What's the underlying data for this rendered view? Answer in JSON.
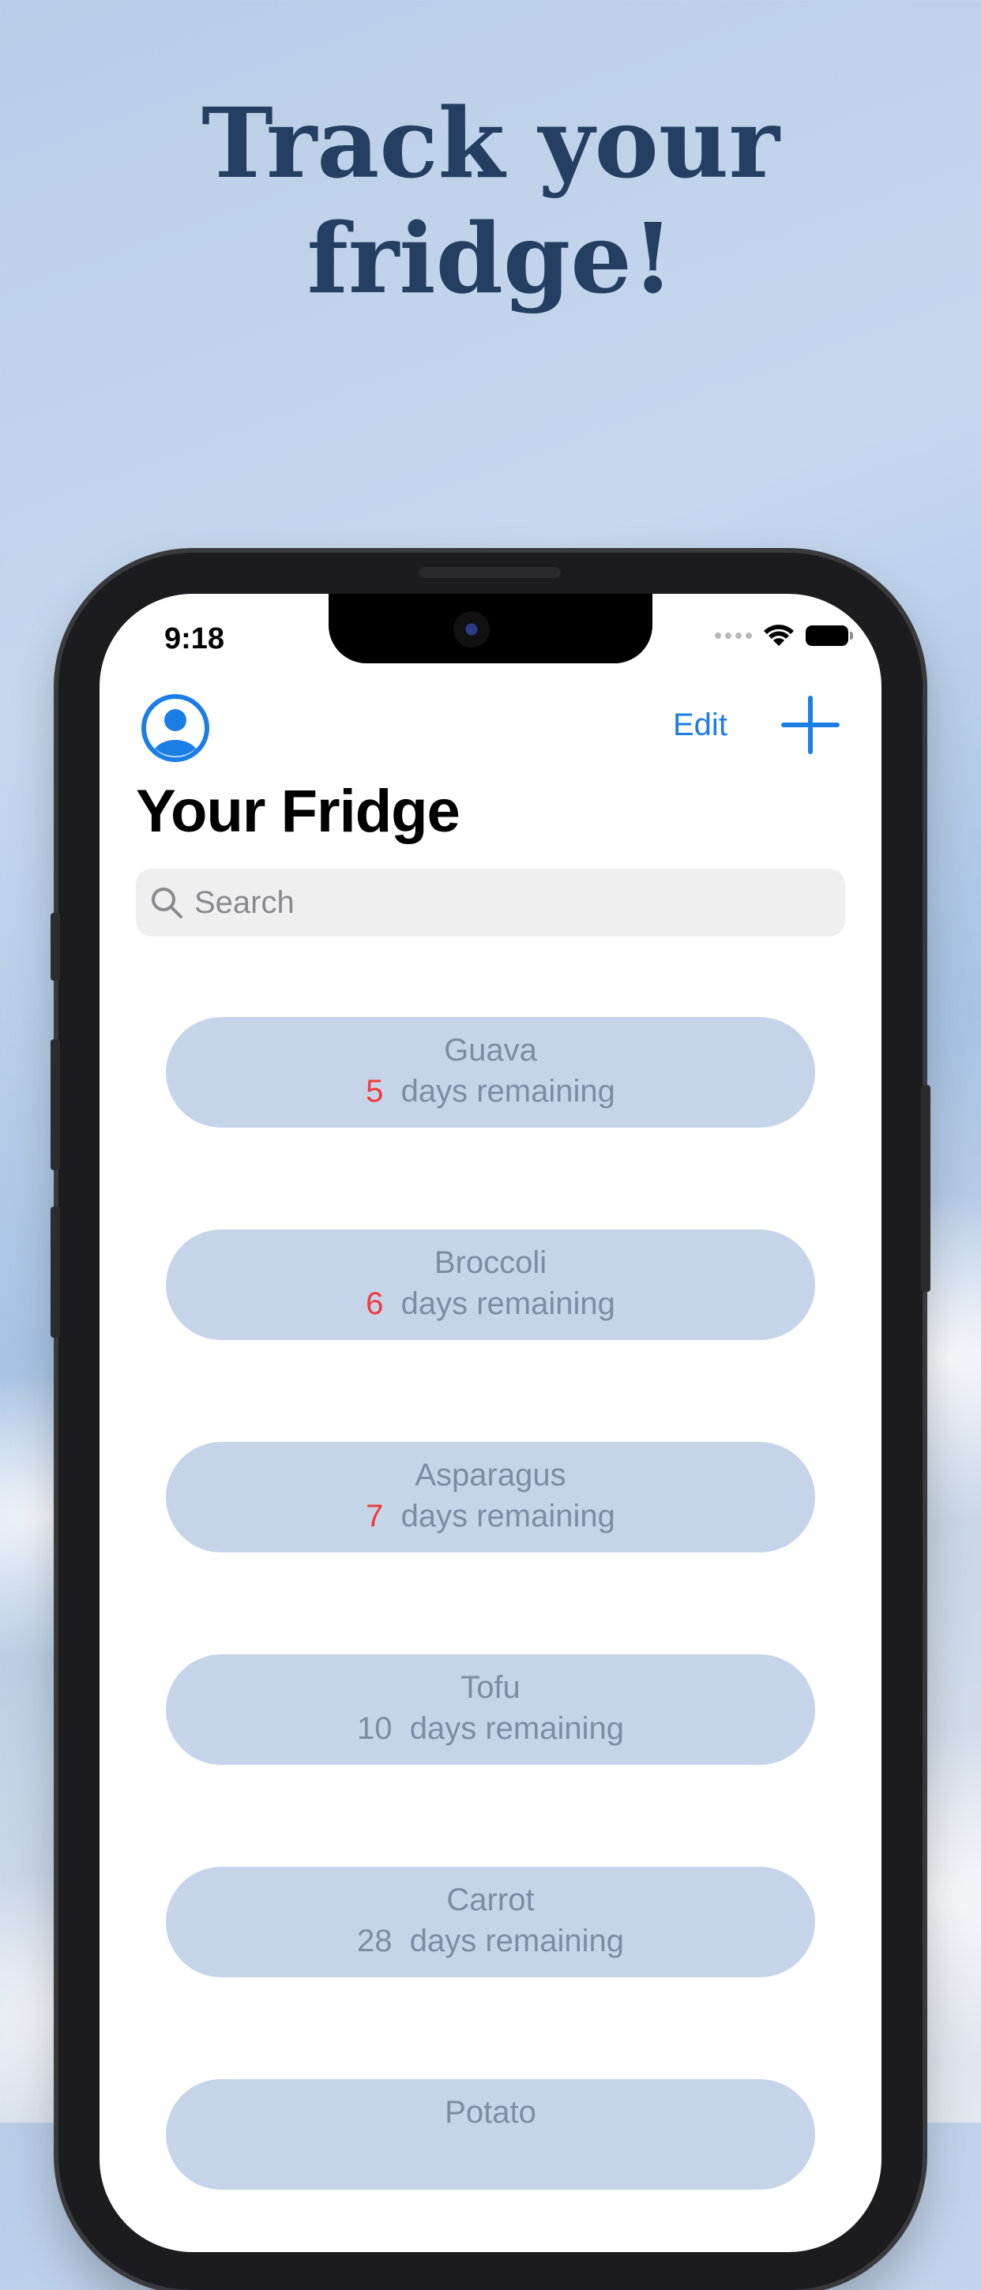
{
  "headline": {
    "line1": "Track your",
    "line2": "fridge!"
  },
  "status_bar": {
    "time": "9:18",
    "wifi_icon": "wifi-icon",
    "battery_icon": "battery-icon"
  },
  "nav": {
    "edit_label": "Edit",
    "avatar_icon": "person-circle-icon",
    "add_icon": "plus-icon"
  },
  "page": {
    "title": "Your Fridge"
  },
  "search": {
    "placeholder": "Search",
    "icon": "magnifying-glass-icon"
  },
  "colors": {
    "accent": "#1a7ee6",
    "urgent": "#ef3b3b",
    "item_bg": "#c6d4ea",
    "item_text": "#7f8ba3",
    "headline": "#243f62"
  },
  "items": [
    {
      "name": "Guava",
      "days": "5",
      "suffix": "  days remaining",
      "urgent": true
    },
    {
      "name": "Broccoli",
      "days": "6",
      "suffix": "  days remaining",
      "urgent": true
    },
    {
      "name": "Asparagus",
      "days": "7",
      "suffix": "  days remaining",
      "urgent": true
    },
    {
      "name": "Tofu",
      "days": "10",
      "suffix": "  days remaining",
      "urgent": false
    },
    {
      "name": "Carrot",
      "days": "28",
      "suffix": "  days remaining",
      "urgent": false
    },
    {
      "name": "Potato",
      "days": "",
      "suffix": "",
      "urgent": false
    }
  ]
}
